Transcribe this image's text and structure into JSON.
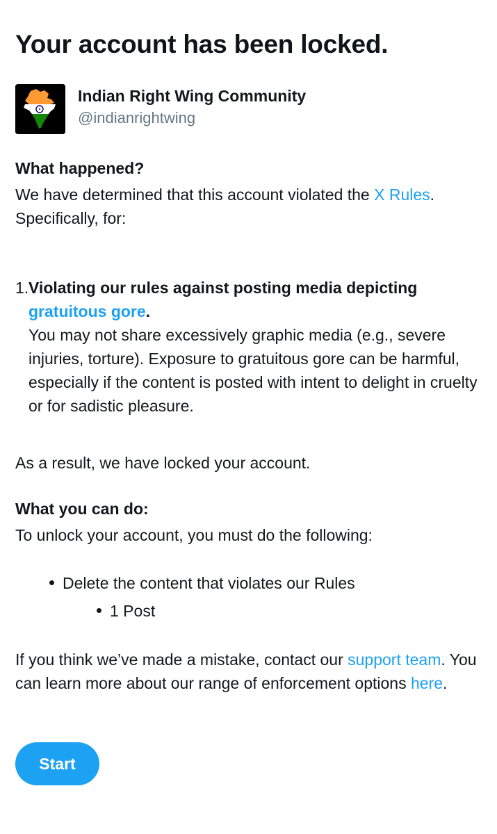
{
  "page": {
    "title": "Your account has been locked."
  },
  "account": {
    "name": "Indian Right Wing Community",
    "handle": "@indianrightwing",
    "avatar_icon": "india-flag-map-icon"
  },
  "what_happened": {
    "heading": "What happened?",
    "text_before_link": "We have determined that this account violated the ",
    "rules_link": "X Rules",
    "text_after_link": ". Specifically, for:"
  },
  "violations": [
    {
      "number": "1.",
      "title_before_link": "Violating our rules against posting media depicting ",
      "title_link": "gratuitous gore",
      "title_after_link": ".",
      "description": "You may not share excessively graphic media (e.g., severe injuries, torture). Exposure to gratuitous gore can be harmful, especially if the content is posted with intent to delight in cruelty or for sadistic pleasure."
    }
  ],
  "result_text": "As a result, we have locked your account.",
  "what_you_can_do": {
    "heading": "What you can do:",
    "text": "To unlock your account, you must do the following:",
    "steps": [
      {
        "label": "Delete the content that violates our Rules",
        "sub_items": [
          "1 Post"
        ]
      }
    ]
  },
  "footer": {
    "text_before_support": "If you think we’ve made a mistake, contact our ",
    "support_link": "support team",
    "text_middle": ". You can learn more about our range of enforcement options ",
    "here_link": "here",
    "text_end": "."
  },
  "start_button": {
    "label": "Start"
  },
  "colors": {
    "link": "#1da1f2",
    "button": "#1da1f2",
    "text": "#14171a",
    "secondary_text": "#657786"
  }
}
